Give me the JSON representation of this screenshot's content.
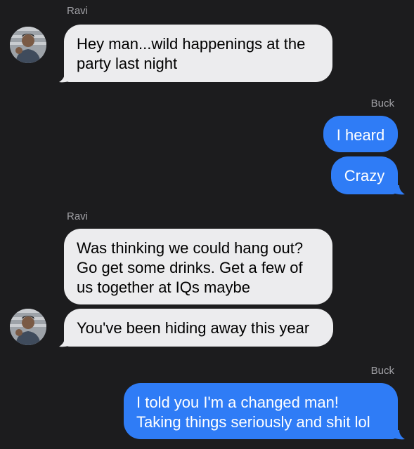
{
  "thread": {
    "messages": [
      {
        "sender": "Ravi",
        "text_lines": [
          "Hey man...wild happenings at the",
          "party last night"
        ]
      },
      {
        "sender": "Buck",
        "text_lines": [
          "I heard"
        ]
      },
      {
        "sender": "Buck",
        "text_lines": [
          "Crazy"
        ]
      },
      {
        "sender": "Ravi",
        "text_lines": [
          "Was thinking we could hang out?",
          "Go get some drinks. Get a few of",
          "us together at IQs maybe"
        ]
      },
      {
        "sender": "Ravi",
        "text_lines": [
          "You've been hiding away this year"
        ]
      },
      {
        "sender": "Buck",
        "text_lines": [
          "I told you I'm a changed man!",
          "Taking things seriously and shit lol"
        ]
      }
    ]
  },
  "colors": {
    "background": "#1c1c1e",
    "incoming_bubble": "#ececee",
    "outgoing_bubble": "#2f7cf6",
    "sender_label": "#a1a1a6"
  },
  "icons": [
    "avatar-ravi"
  ]
}
